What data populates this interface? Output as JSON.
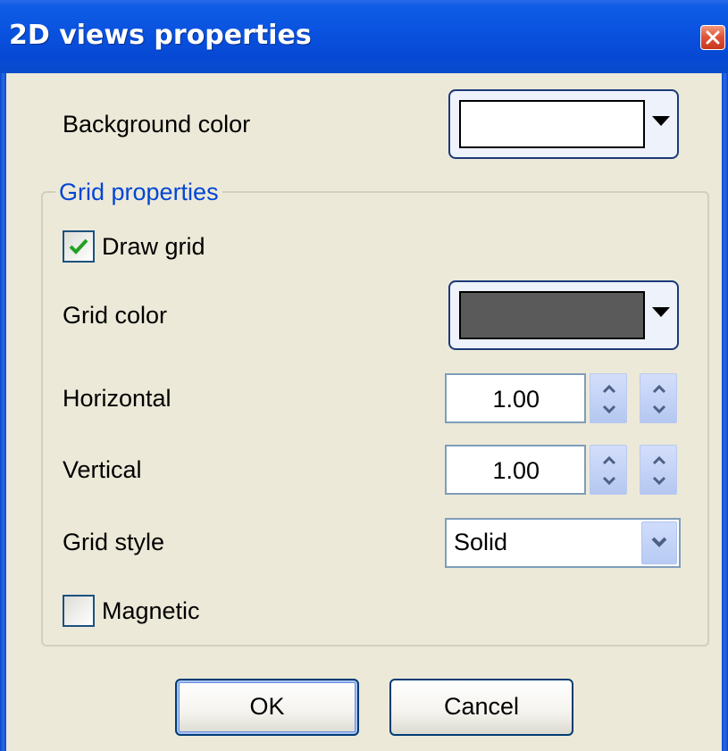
{
  "window": {
    "title": "2D views properties",
    "close_icon": "close-icon"
  },
  "background": {
    "label": "Background color",
    "color": "#ffffff"
  },
  "grid_group": {
    "title": "Grid properties",
    "draw_grid": {
      "label": "Draw grid",
      "checked": true
    },
    "grid_color": {
      "label": "Grid color",
      "color": "#5a5a5a"
    },
    "horizontal": {
      "label": "Horizontal",
      "value": "1.00"
    },
    "vertical": {
      "label": "Vertical",
      "value": "1.00"
    },
    "grid_style": {
      "label": "Grid style",
      "selected": "Solid"
    },
    "magnetic": {
      "label": "Magnetic",
      "checked": false
    }
  },
  "buttons": {
    "ok": "OK",
    "cancel": "Cancel"
  },
  "colors": {
    "titlebar": "#0a53e0",
    "dialog_bg": "#ece9d8",
    "group_title": "#0046d5",
    "check_mark": "#21a121"
  }
}
